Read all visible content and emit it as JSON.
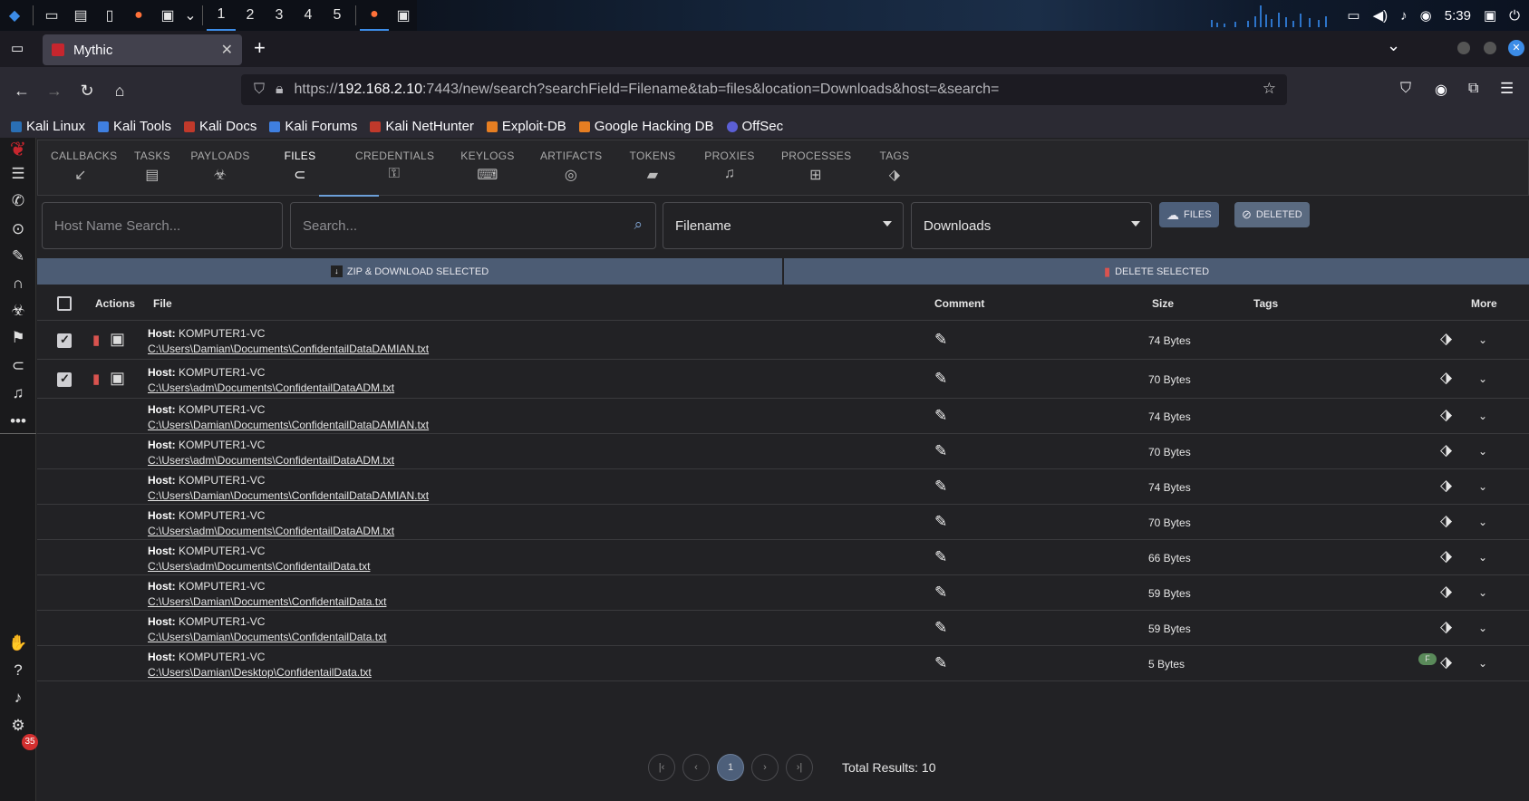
{
  "taskbar": {
    "workspaces": [
      "1",
      "2",
      "3",
      "4",
      "5"
    ],
    "time": "5:39"
  },
  "browser": {
    "tab_title": "Mythic",
    "url_prefix": "https://",
    "url_host": "192.168.2.10",
    "url_rest": ":7443/new/search?searchField=Filename&tab=files&location=Downloads&host=&search=",
    "bookmarks": [
      "Kali Linux",
      "Kali Tools",
      "Kali Docs",
      "Kali Forums",
      "Kali NetHunter",
      "Exploit-DB",
      "Google Hacking DB",
      "OffSec"
    ]
  },
  "nav_tabs": [
    "CALLBACKS",
    "TASKS",
    "PAYLOADS",
    "FILES",
    "CREDENTIALS",
    "KEYLOGS",
    "ARTIFACTS",
    "TOKENS",
    "PROXIES",
    "PROCESSES",
    "TAGS"
  ],
  "search": {
    "host_placeholder": "Host Name Search...",
    "search_placeholder": "Search...",
    "field_value": "Filename",
    "location_value": "Downloads",
    "files_label": "FILES",
    "deleted_label": "DELETED"
  },
  "actions": {
    "zip_label": "ZIP & DOWNLOAD SELECTED",
    "delete_label": "DELETE SELECTED"
  },
  "table": {
    "headers": {
      "actions": "Actions",
      "file": "File",
      "comment": "Comment",
      "size": "Size",
      "tags": "Tags",
      "more": "More"
    },
    "host_label": "Host:",
    "rows": [
      {
        "host": "KOMPUTER1-VC",
        "path": "C:\\Users\\Damian\\Documents\\ConfidentailDataDAMIAN.txt",
        "size": "74 Bytes",
        "checked": true
      },
      {
        "host": "KOMPUTER1-VC",
        "path": "C:\\Users\\adm\\Documents\\ConfidentailDataADM.txt",
        "size": "70 Bytes",
        "checked": true
      },
      {
        "host": "KOMPUTER1-VC",
        "path": "C:\\Users\\Damian\\Documents\\ConfidentailDataDAMIAN.txt",
        "size": "74 Bytes"
      },
      {
        "host": "KOMPUTER1-VC",
        "path": "C:\\Users\\adm\\Documents\\ConfidentailDataADM.txt",
        "size": "70 Bytes"
      },
      {
        "host": "KOMPUTER1-VC",
        "path": "C:\\Users\\Damian\\Documents\\ConfidentailDataDAMIAN.txt",
        "size": "74 Bytes"
      },
      {
        "host": "KOMPUTER1-VC",
        "path": "C:\\Users\\adm\\Documents\\ConfidentailDataADM.txt",
        "size": "70 Bytes"
      },
      {
        "host": "KOMPUTER1-VC",
        "path": "C:\\Users\\adm\\Documents\\ConfidentailData.txt",
        "size": "66 Bytes"
      },
      {
        "host": "KOMPUTER1-VC",
        "path": "C:\\Users\\Damian\\Documents\\ConfidentailData.txt",
        "size": "59 Bytes"
      },
      {
        "host": "KOMPUTER1-VC",
        "path": "C:\\Users\\Damian\\Documents\\ConfidentailData.txt",
        "size": "59 Bytes"
      },
      {
        "host": "KOMPUTER1-VC",
        "path": "C:\\Users\\Damian\\Desktop\\ConfidentailData.txt",
        "size": "5 Bytes",
        "tag_chip": "F"
      }
    ]
  },
  "pagination": {
    "current": "1",
    "total_label": "Total Results: 10"
  },
  "notifications": {
    "count": "35"
  }
}
